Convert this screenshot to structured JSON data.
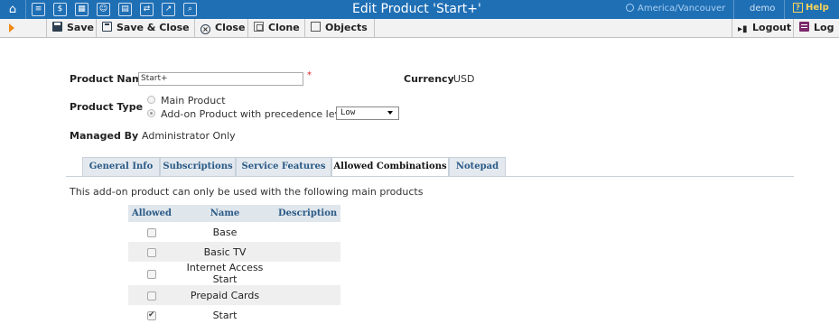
{
  "topbar": {
    "title": "Edit Product 'Start+'",
    "timezone": "America/Vancouver",
    "user": "demo",
    "help_label": "Help",
    "icons": [
      "home-icon",
      "list-icon",
      "dollar-icon",
      "grid-icon",
      "person-icon",
      "card-icon",
      "transfer-icon",
      "chart-icon",
      "search-icon"
    ],
    "colors": {
      "bar": "#1f6fb5",
      "help": "#f7d35a"
    }
  },
  "toolbar": {
    "save_label": "Save",
    "save_close_label": "Save & Close",
    "close_label": "Close",
    "clone_label": "Clone",
    "objects_label": "Objects",
    "logout_label": "Logout",
    "log_label": "Log"
  },
  "form": {
    "product_name_label": "Product Name",
    "product_name_value": "Start+",
    "required_mark": "*",
    "currency_label": "Currency",
    "currency_value": "USD",
    "product_type_label": "Product Type",
    "main_product_option": "Main Product",
    "addon_product_option": "Add-on Product with precedence level",
    "selected_type": "addon",
    "precedence_value": "Low",
    "managed_by_label": "Managed By",
    "managed_by_value": "Administrator Only"
  },
  "tabs": [
    {
      "label": "General Info"
    },
    {
      "label": "Subscriptions"
    },
    {
      "label": "Service Features"
    },
    {
      "label": "Allowed Combinations"
    },
    {
      "label": "Notepad"
    }
  ],
  "active_tab": "Allowed Combinations",
  "combinations": {
    "intro": "This add-on product can only be used with the following main products",
    "columns": [
      "Allowed",
      "Name",
      "Description"
    ],
    "rows": [
      {
        "allowed": false,
        "name": "Base",
        "description": ""
      },
      {
        "allowed": false,
        "name": "Basic TV",
        "description": ""
      },
      {
        "allowed": false,
        "name": "Internet Access Start",
        "description": ""
      },
      {
        "allowed": false,
        "name": "Prepaid Cards",
        "description": ""
      },
      {
        "allowed": true,
        "name": "Start",
        "description": ""
      }
    ]
  }
}
